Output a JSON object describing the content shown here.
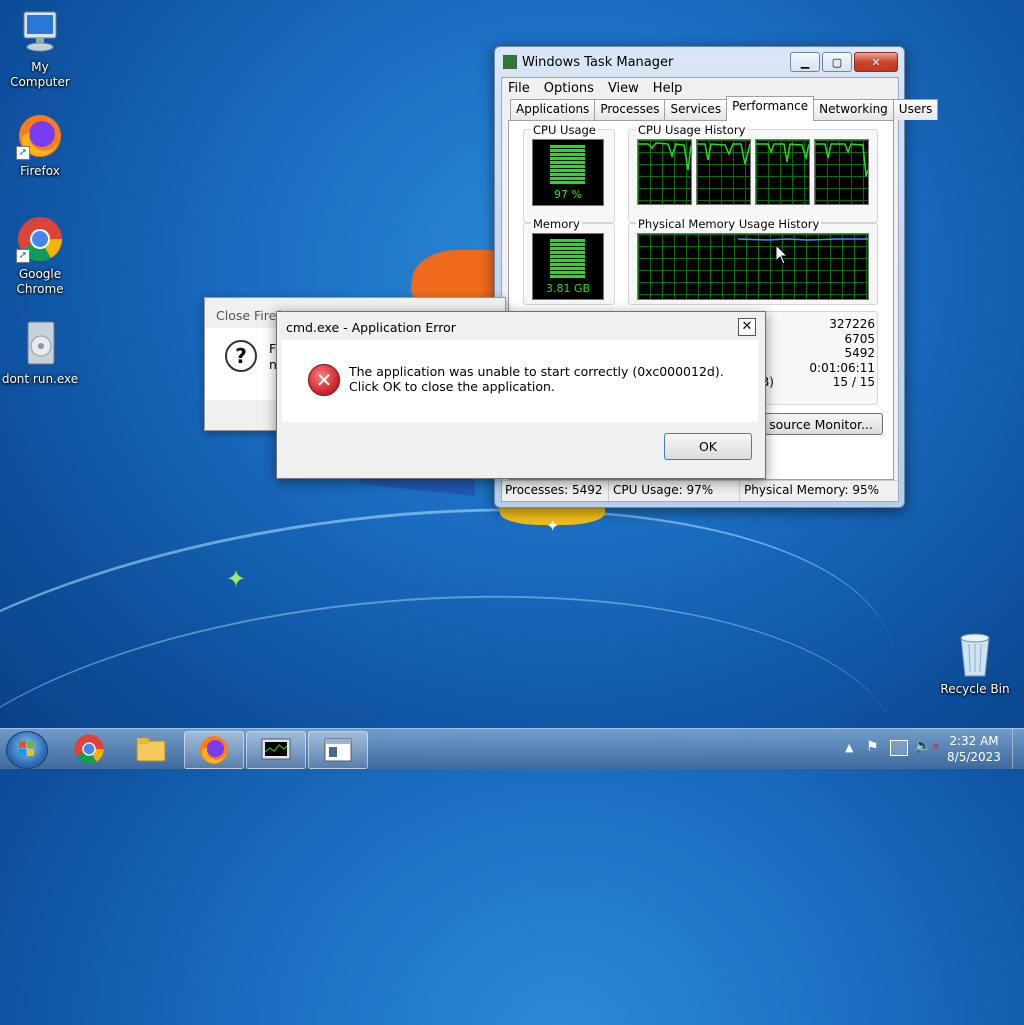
{
  "desktop": {
    "icons": [
      {
        "label": "My Computer"
      },
      {
        "label": "Firefox"
      },
      {
        "label": "Google\nChrome"
      },
      {
        "label": "dont run.exe"
      },
      {
        "label": "Recycle Bin"
      }
    ]
  },
  "task_manager": {
    "title": "Windows Task Manager",
    "menu": [
      "File",
      "Options",
      "View",
      "Help"
    ],
    "tabs": [
      "Applications",
      "Processes",
      "Services",
      "Performance",
      "Networking",
      "Users"
    ],
    "active_tab": "Performance",
    "cpu_usage_label": "CPU Usage",
    "cpu_usage_value": "97 %",
    "cpu_history_label": "CPU Usage History",
    "memory_label": "Memory",
    "memory_value": "3.81 GB",
    "memory_history_label": "Physical Memory Usage History",
    "stats_values": [
      "327226",
      "6705",
      "5492",
      "0:01:06:11",
      "15 / 15"
    ],
    "stats_partial_label": "B)",
    "resource_monitor_button": "source Monitor...",
    "status": {
      "processes": "Processes: 5492",
      "cpu": "CPU Usage: 97%",
      "memory": "Physical Memory: 95%"
    }
  },
  "close_firefox_dialog": {
    "title": "Close Firefo",
    "text_line1": "F",
    "text_line2": "n"
  },
  "error_dialog": {
    "title": "cmd.exe - Application Error",
    "message": "The application was unable to start correctly (0xc000012d). Click OK to close the application.",
    "ok_label": "OK"
  },
  "taskbar": {
    "time": "2:32 AM",
    "date": "8/5/2023"
  },
  "colors": {
    "graph_green": "#1ee01e",
    "error_red": "#c8202a",
    "memory_line": "#4c8cff"
  }
}
